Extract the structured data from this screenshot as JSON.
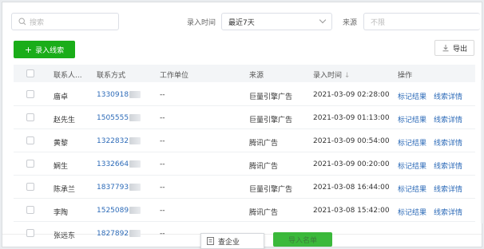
{
  "toolbar": {
    "search_placeholder": "搜索",
    "entry_time_label": "录入时间",
    "entry_time_value": "最近7天",
    "source_label": "来源",
    "source_placeholder": "不限",
    "add_lead_label": "录入线索",
    "export_label": "导出"
  },
  "table": {
    "headers": {
      "contact": "联系人...",
      "phone": "联系方式",
      "company": "工作单位",
      "source": "来源",
      "entry_time": "录入时间",
      "entry_time_sort": "↓",
      "actions": "操作"
    },
    "rows": [
      {
        "name": "庿卓",
        "phone": "1330918",
        "company": "--",
        "source": "巨量引擎广告",
        "time": "2021-03-09 02:28:00",
        "mark": "标记结果",
        "detail": "线索详情"
      },
      {
        "name": "赵先生",
        "phone": "1505555",
        "company": "--",
        "source": "巨量引擎广告",
        "time": "2021-03-09 01:13:00",
        "mark": "标记结果",
        "detail": "线索详情"
      },
      {
        "name": "黄黎",
        "phone": "1322832",
        "company": "--",
        "source": "腾讯广告",
        "time": "2021-03-09 00:54:00",
        "mark": "标记结果",
        "detail": "线索详情"
      },
      {
        "name": "娴生",
        "phone": "1332664",
        "company": "--",
        "source": "腾讯广告",
        "time": "2021-03-09 00:20:00",
        "mark": "标记结果",
        "detail": "线索详情"
      },
      {
        "name": "陈承兰",
        "phone": "1837793",
        "company": "--",
        "source": "巨量引擎广告",
        "time": "2021-03-08 16:44:00",
        "mark": "标记结果",
        "detail": "线索详情"
      },
      {
        "name": "李陶",
        "phone": "1525089",
        "company": "--",
        "source": "腾讯广告",
        "time": "2021-03-08 15:42:00",
        "mark": "标记结果",
        "detail": "线索详情"
      },
      {
        "name": "张远东",
        "phone": "1827892",
        "company": "--",
        "source": "",
        "time": "",
        "mark": "",
        "detail": ""
      }
    ]
  },
  "footer": {
    "popup_label": "查企业",
    "import_label": "导入名单"
  },
  "colors": {
    "primary_green": "#1aad19",
    "link_blue": "#2d6bb8"
  }
}
